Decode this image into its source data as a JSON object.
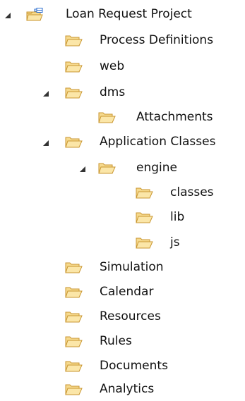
{
  "tree": {
    "project": {
      "label": "Loan Request Project",
      "icon": "project-folder-icon",
      "expanded": true
    },
    "items": [
      {
        "label": "Process Definitions",
        "icon": "folder-icon"
      },
      {
        "label": "web",
        "icon": "folder-icon"
      },
      {
        "label": "dms",
        "icon": "folder-icon",
        "expanded": true
      },
      {
        "label": "Attachments",
        "icon": "folder-icon"
      },
      {
        "label": "Application Classes",
        "icon": "folder-icon",
        "expanded": true
      },
      {
        "label": "engine",
        "icon": "folder-icon",
        "expanded": true
      },
      {
        "label": "classes",
        "icon": "folder-icon"
      },
      {
        "label": "lib",
        "icon": "folder-icon"
      },
      {
        "label": "js",
        "icon": "folder-icon"
      },
      {
        "label": "Simulation",
        "icon": "folder-icon"
      },
      {
        "label": "Calendar",
        "icon": "folder-icon"
      },
      {
        "label": "Resources",
        "icon": "folder-icon"
      },
      {
        "label": "Rules",
        "icon": "folder-icon"
      },
      {
        "label": "Documents",
        "icon": "folder-icon"
      },
      {
        "label": "Analytics",
        "icon": "folder-icon"
      }
    ]
  },
  "colors": {
    "folder_fill": "#f6da8e",
    "folder_stroke": "#c99630",
    "project_badge": "#2e6fd0",
    "text": "#111111",
    "toggle": "#333333"
  }
}
